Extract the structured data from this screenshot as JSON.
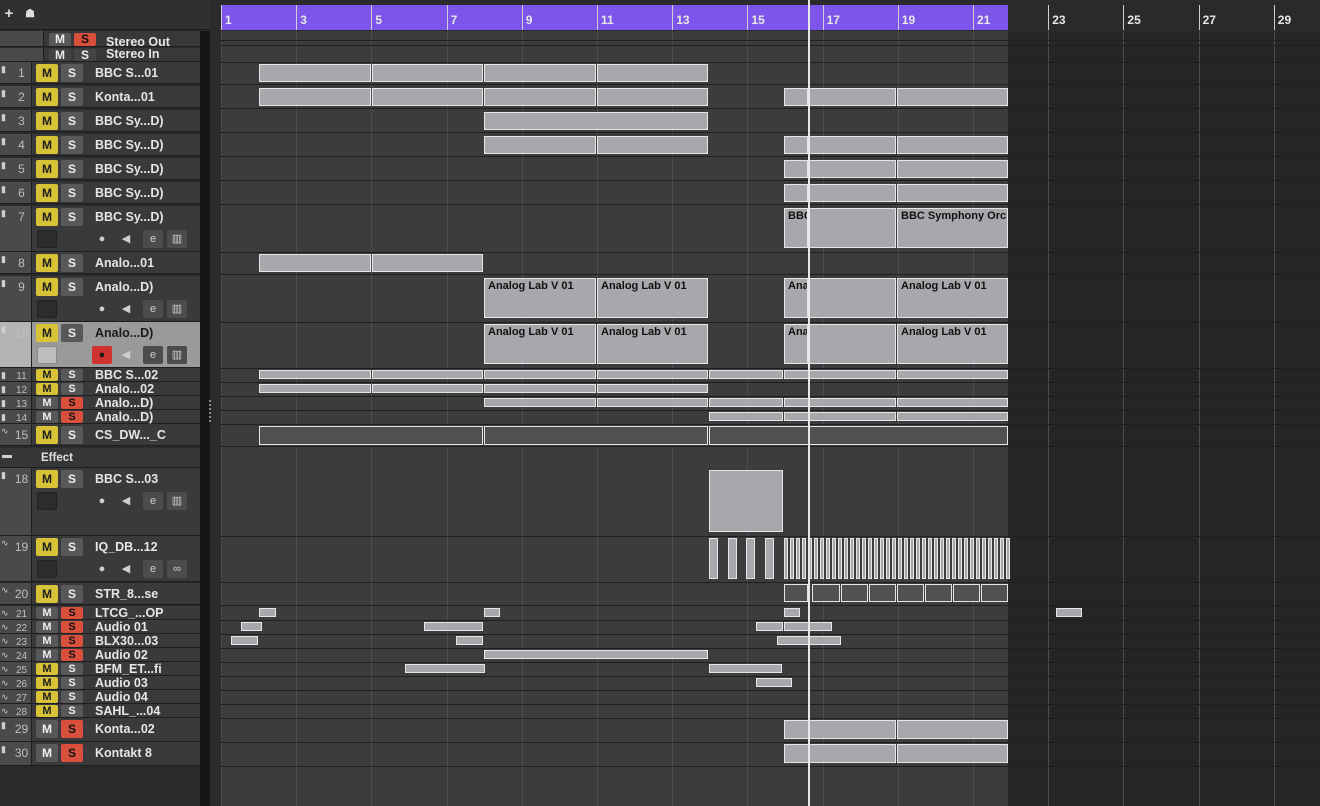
{
  "colors": {
    "cycle": "#7d55ea",
    "mute_on": "#d8c237",
    "solo_on": "#d8503c",
    "part": "#a8a8ac",
    "rec_on": "#d0322f"
  },
  "toolbar": {
    "add_icon": "+",
    "settings_icon": "☗"
  },
  "ruler": {
    "labels": [
      "1",
      "3",
      "5",
      "7",
      "9",
      "11",
      "13",
      "15",
      "17",
      "19",
      "21",
      "23",
      "25",
      "27",
      "29"
    ]
  },
  "common": {
    "mute_label": "M",
    "solo_label": "S"
  },
  "master": [
    {
      "name": "Stereo Out",
      "mute": "M",
      "solo": "S",
      "solo_on": true
    },
    {
      "name": "Stereo In",
      "mute": "M",
      "solo": "S",
      "solo_on": false
    }
  ],
  "tracks": [
    {
      "num": "1",
      "name": "BBC S...01",
      "mute_on": true,
      "solo_on": false,
      "icon": "midi"
    },
    {
      "num": "2",
      "name": "Konta...01",
      "mute_on": true,
      "solo_on": false,
      "icon": "midi"
    },
    {
      "num": "3",
      "name": "BBC Sy...D)",
      "mute_on": true,
      "solo_on": false,
      "icon": "midi"
    },
    {
      "num": "4",
      "name": "BBC Sy...D)",
      "mute_on": true,
      "solo_on": false,
      "icon": "midi"
    },
    {
      "num": "5",
      "name": "BBC Sy...D)",
      "mute_on": true,
      "solo_on": false,
      "icon": "midi"
    },
    {
      "num": "6",
      "name": "BBC Sy...D)",
      "mute_on": true,
      "solo_on": false,
      "icon": "midi"
    },
    {
      "num": "7",
      "name": "BBC Sy...D)",
      "mute_on": true,
      "solo_on": false,
      "icon": "midi"
    },
    {
      "num": "8",
      "name": "Analo...01",
      "mute_on": true,
      "solo_on": false,
      "icon": "midi"
    },
    {
      "num": "9",
      "name": "Analo...D)",
      "mute_on": true,
      "solo_on": false,
      "icon": "midi"
    },
    {
      "num": "10",
      "name": "Analo...D)",
      "mute_on": true,
      "solo_on": false,
      "icon": "midi"
    },
    {
      "num": "11",
      "name": "BBC S...02",
      "mute_on": true,
      "solo_on": false,
      "icon": "midi"
    },
    {
      "num": "12",
      "name": "Analo...02",
      "mute_on": true,
      "solo_on": false,
      "icon": "midi"
    },
    {
      "num": "13",
      "name": "Analo...D)",
      "mute_on": false,
      "solo_on": true,
      "icon": "midi"
    },
    {
      "num": "14",
      "name": "Analo...D)",
      "mute_on": false,
      "solo_on": true,
      "icon": "midi"
    },
    {
      "num": "15",
      "name": "CS_DW..._C",
      "mute_on": true,
      "solo_on": false,
      "icon": "audio"
    },
    {
      "num": "18",
      "name": "BBC S...03",
      "mute_on": true,
      "solo_on": false,
      "icon": "midi"
    },
    {
      "num": "19",
      "name": "IQ_DB...12",
      "mute_on": true,
      "solo_on": false,
      "icon": "audio"
    },
    {
      "num": "20",
      "name": "STR_8...se",
      "mute_on": true,
      "solo_on": false,
      "icon": "audio"
    },
    {
      "num": "21",
      "name": "LTCG_...OP",
      "mute_on": false,
      "solo_on": true,
      "icon": "audio"
    },
    {
      "num": "22",
      "name": "Audio 01",
      "mute_on": false,
      "solo_on": true,
      "icon": "audio"
    },
    {
      "num": "23",
      "name": "BLX30...03",
      "mute_on": false,
      "solo_on": true,
      "icon": "audio"
    },
    {
      "num": "24",
      "name": "Audio 02",
      "mute_on": false,
      "solo_on": true,
      "icon": "audio"
    },
    {
      "num": "25",
      "name": "BFM_ET...fi",
      "mute_on": true,
      "solo_on": false,
      "icon": "audio"
    },
    {
      "num": "26",
      "name": "Audio 03",
      "mute_on": true,
      "solo_on": false,
      "icon": "audio"
    },
    {
      "num": "27",
      "name": "Audio 04",
      "mute_on": true,
      "solo_on": false,
      "icon": "audio"
    },
    {
      "num": "28",
      "name": "SAHL_...04",
      "mute_on": true,
      "solo_on": false,
      "icon": "audio"
    },
    {
      "num": "29",
      "name": "Konta...02",
      "mute_on": false,
      "solo_on": true,
      "icon": "midi"
    },
    {
      "num": "30",
      "name": "Kontakt 8",
      "mute_on": false,
      "solo_on": true,
      "icon": "midi"
    }
  ],
  "folder": {
    "name": "Effect"
  },
  "part_labels": {
    "bbc": "BBC Symphony Orch",
    "analog": "Analog Lab V 01"
  }
}
